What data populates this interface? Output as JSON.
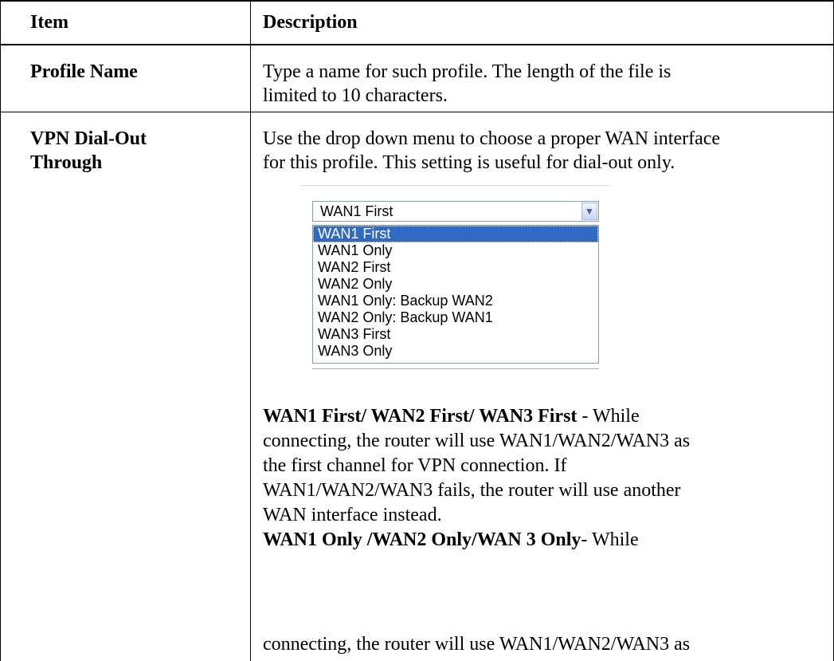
{
  "table": {
    "header": {
      "item": "Item",
      "description": "Description"
    },
    "rows": [
      {
        "item": "Profile Name",
        "description": [
          "Type a name for such profile. The length of the file is",
          "limited to 10 characters."
        ]
      },
      {
        "item_lines": [
          "VPN Dial-Out",
          "Through"
        ],
        "description": [
          "Use the drop down menu to choose a proper WAN interface",
          "for this profile. This setting is useful for dial-out only."
        ],
        "dropdown": {
          "selected": "WAN1 First",
          "options": [
            "WAN1 First",
            "WAN1 Only",
            "WAN2 First",
            "WAN2 Only",
            "WAN1 Only: Backup WAN2",
            "WAN2 Only: Backup WAN1",
            "WAN3 First",
            "WAN3 Only"
          ]
        },
        "notes": [
          {
            "term": "WAN1 First/ WAN2 First/ WAN3 First",
            "first_line_rest": " - While",
            "lines": [
              "connecting, the router will use WAN1/WAN2/WAN3 as",
              "the first channel for VPN connection. If",
              "WAN1/WAN2/WAN3 fails, the router will use another",
              "WAN interface instead."
            ]
          },
          {
            "term": "WAN1 Only /WAN2 Only/WAN 3 Only",
            "first_line_rest": "- While",
            "lines": [
              "connecting, the router will use WAN1/WAN2/WAN3 as"
            ]
          }
        ]
      }
    ]
  }
}
